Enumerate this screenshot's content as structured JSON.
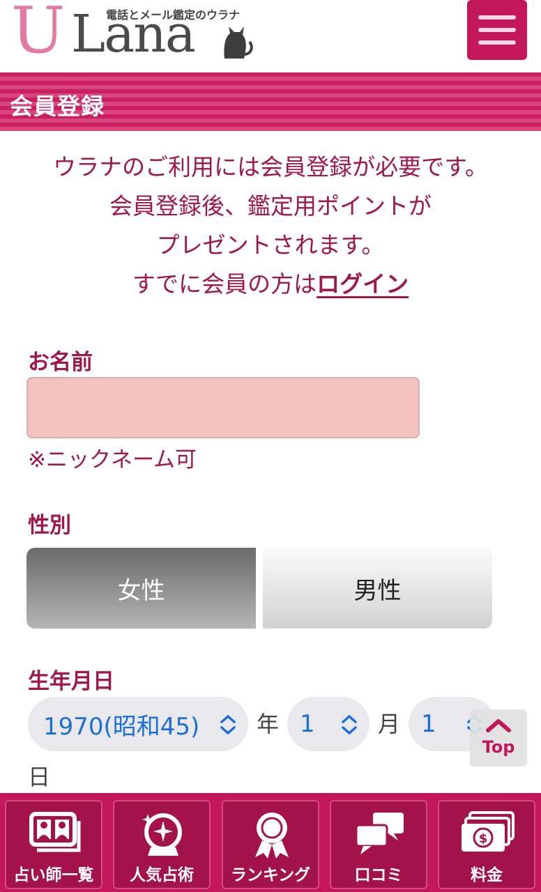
{
  "header": {
    "logo_u": "U",
    "logo_lana": "Lana",
    "tagline": "電話とメール鑑定のウラナ"
  },
  "section": {
    "title": "会員登録"
  },
  "intro": {
    "line1": "ウラナのご利用には会員登録が必要です。",
    "line2": "会員登録後、鑑定用ポイントが",
    "line3": "プレゼントされます。",
    "line4_prefix": "すでに会員の方は",
    "login_link": "ログイン"
  },
  "form": {
    "name_label": "お名前",
    "name_value": "",
    "name_hint": "※ニックネーム可",
    "gender_label": "性別",
    "gender_female": "女性",
    "gender_male": "男性",
    "gender_selected": "女性",
    "birthday_label": "生年月日",
    "year_value": "1970(昭和45)",
    "year_unit": "年",
    "month_value": "1",
    "month_unit": "月",
    "day_value": "1",
    "day_unit": "日"
  },
  "top_button": {
    "label": "Top"
  },
  "bottom_nav": [
    {
      "label": "占い師一覧",
      "icon": "fortune-tellers-icon"
    },
    {
      "label": "人気占術",
      "icon": "crystal-ball-icon"
    },
    {
      "label": "ランキング",
      "icon": "ranking-medal-icon"
    },
    {
      "label": "口コミ",
      "icon": "reviews-chat-icon"
    },
    {
      "label": "料金",
      "icon": "money-icon"
    }
  ],
  "colors": {
    "brand": "#c2185b",
    "text_accent": "#a01848",
    "input_bg": "#f4c2c2",
    "select_text": "#1c6ed8"
  }
}
